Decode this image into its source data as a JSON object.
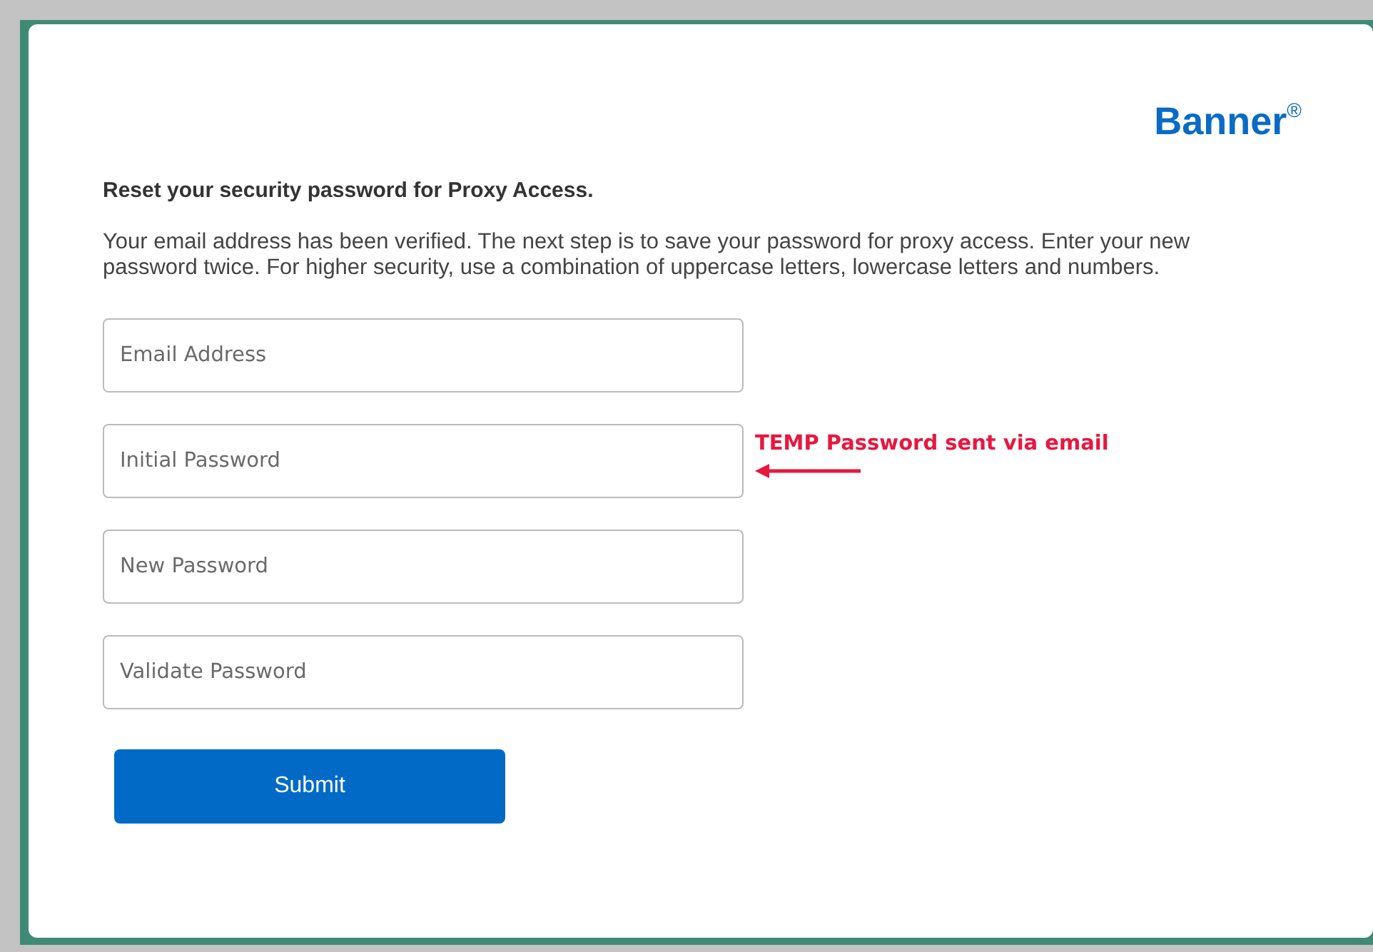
{
  "logo": "Banner$^{®}$",
  "heading": "Reset your security password for Proxy Access.",
  "intro": "Your email address has been verified. The next step is to save your password for proxy access. Enter your new password twice. For higher security, use a combination of uppercase letters, lowercase letters and numbers.",
  "fields": [
    {
      "placeholder": "Email Address"
    },
    {
      "placeholder": "Initial Password",
      "note": "TEMP Password sent via email"
    },
    {
      "placeholder": "New Password"
    },
    {
      "placeholder": "Validate Password"
    }
  ],
  "submit": "Submit"
}
